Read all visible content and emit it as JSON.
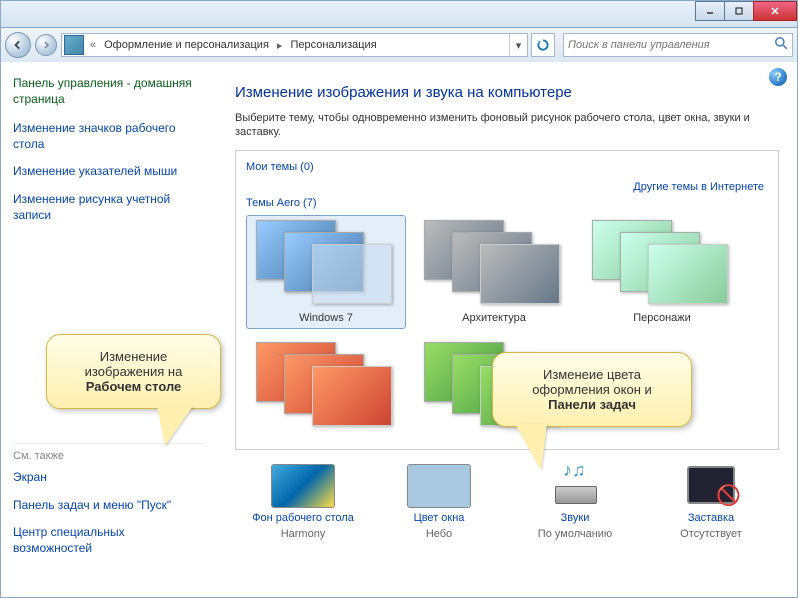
{
  "breadcrumb": {
    "seg1": "Оформление и персонализация",
    "seg2": "Персонализация"
  },
  "search": {
    "placeholder": "Поиск в панели управления"
  },
  "sidebar": {
    "home": "Панель управления - домашняя страница",
    "links": [
      "Изменение значков рабочего стола",
      "Изменение указателей мыши",
      "Изменение рисунка учетной записи"
    ],
    "seealso_label": "См. также",
    "seealso": [
      "Экран",
      "Панель задач и меню \"Пуск\"",
      "Центр специальных возможностей"
    ]
  },
  "main": {
    "title": "Изменение изображения и звука на компьютере",
    "desc": "Выберите тему, чтобы одновременно изменить фоновый рисунок рабочего стола, цвет окна, звуки и заставку.",
    "group_my": "Мои темы (0)",
    "group_aero": "Темы Aero (7)",
    "online_link": "Другие темы в Интернете",
    "themes": [
      {
        "name": "Windows 7",
        "cls": "win7 sel"
      },
      {
        "name": "Архитектура",
        "cls": "arch"
      },
      {
        "name": "Персонажи",
        "cls": "char"
      },
      {
        "name": "",
        "cls": "land"
      },
      {
        "name": "",
        "cls": "nat"
      }
    ]
  },
  "bottom": {
    "bg": {
      "link": "Фон рабочего стола",
      "sub": "Harmony"
    },
    "color": {
      "link": "Цвет окна",
      "sub": "Небо"
    },
    "sound": {
      "link": "Звуки",
      "sub": "По умолчанию"
    },
    "saver": {
      "link": "Заставка",
      "sub": "Отсутствует"
    }
  },
  "callouts": {
    "c1_line1": "Изменение изображения на",
    "c1_bold": "Рабочем столе",
    "c2_line1": "Изменеие цвета оформления окон и",
    "c2_bold": "Панели задач"
  }
}
